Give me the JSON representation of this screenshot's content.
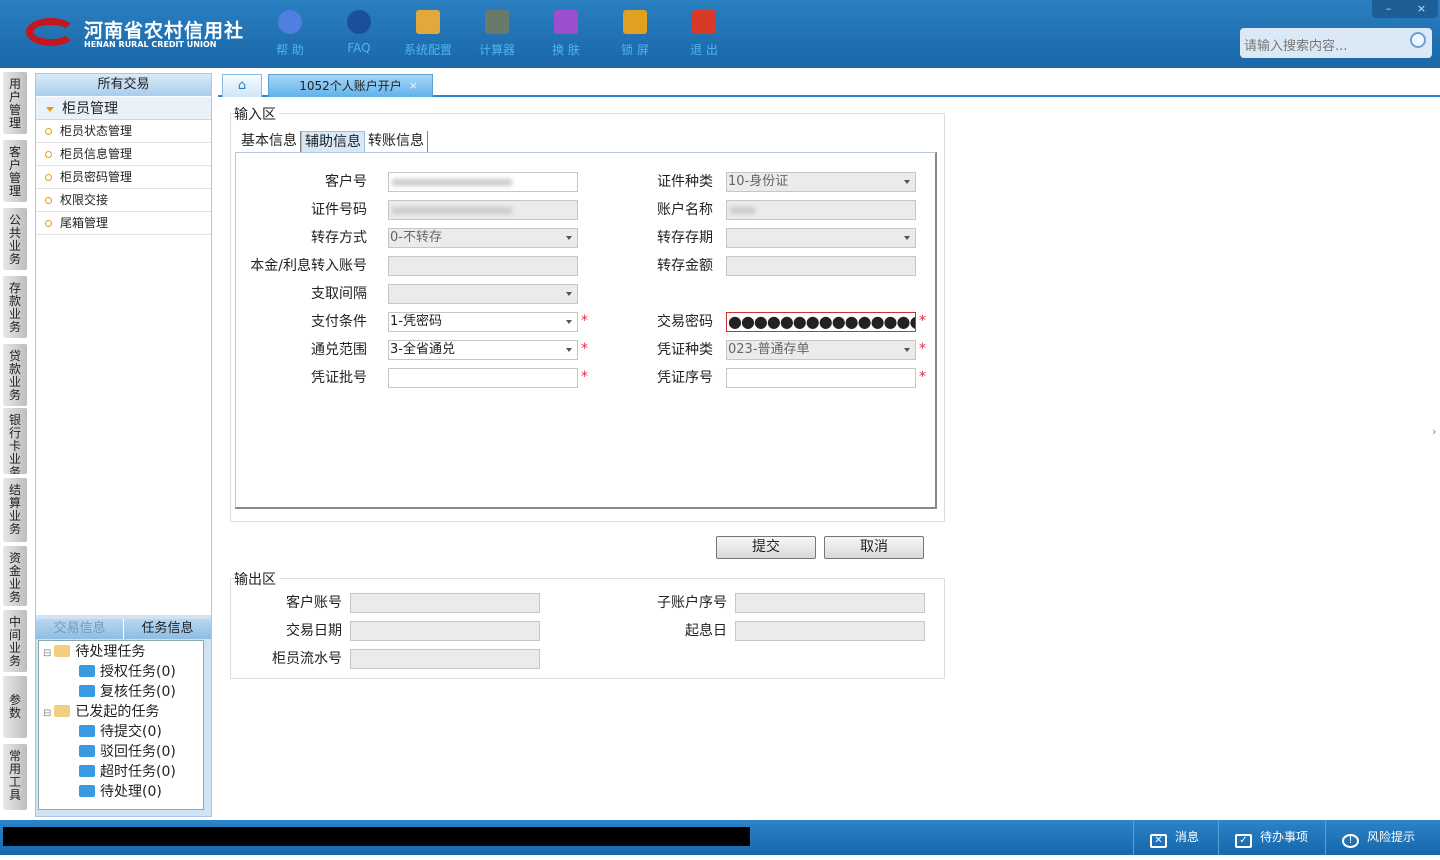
{
  "header": {
    "logo_cn": "河南省农村信用社",
    "logo_en": "HENAN RURAL CREDIT UNION",
    "tools": [
      {
        "label": "帮 助",
        "icon": "info-icon",
        "color": "#4f7fe0"
      },
      {
        "label": "FAQ",
        "icon": "question-icon",
        "color": "#1b4f99"
      },
      {
        "label": "系统配置",
        "icon": "toolbox-icon",
        "color": "#e2a83c"
      },
      {
        "label": "计算器",
        "icon": "calculator-icon",
        "color": "#6a7a6a"
      },
      {
        "label": "换 肤",
        "icon": "shirt-icon",
        "color": "#9b4fd0"
      },
      {
        "label": "锁 屏",
        "icon": "lock-icon",
        "color": "#e0a020"
      },
      {
        "label": "退 出",
        "icon": "power-icon",
        "color": "#d83a2a"
      }
    ],
    "search_placeholder": "请输入搜索内容...",
    "minimize": "–",
    "close": "×"
  },
  "vtabs": [
    "用户管理",
    "客户管理",
    "公共业务",
    "存款业务",
    "贷款业务",
    "银行卡业务",
    "结算业务",
    "资金业务",
    "中间业务",
    "参数",
    "常用工具"
  ],
  "left": {
    "header": "所有交易",
    "group": "柜员管理",
    "items": [
      "柜员状态管理",
      "柜员信息管理",
      "柜员密码管理",
      "权限交接",
      "尾箱管理"
    ],
    "bottom_tabs": [
      "交易信息",
      "任务信息"
    ],
    "tree": [
      {
        "label": "待处理任务",
        "level": 0
      },
      {
        "label": "授权任务(0)",
        "level": 1
      },
      {
        "label": "复核任务(0)",
        "level": 1
      },
      {
        "label": "已发起的任务",
        "level": 0
      },
      {
        "label": "待提交(0)",
        "level": 1
      },
      {
        "label": "驳回任务(0)",
        "level": 1
      },
      {
        "label": "超时任务(0)",
        "level": 1
      },
      {
        "label": "待处理(0)",
        "level": 1
      }
    ]
  },
  "tabs": {
    "active": "1052个人账户开户",
    "close": "×"
  },
  "input_area": {
    "legend": "输入区",
    "subtabs": [
      "基本信息",
      "辅助信息",
      "转账信息"
    ],
    "active_subtab": 1,
    "fields": [
      {
        "label": "客户号",
        "value": "",
        "blurred": true,
        "col": 0,
        "row": 0
      },
      {
        "label": "证件种类",
        "value": "10-身份证",
        "disabled": true,
        "dropdown": true,
        "col": 1,
        "row": 0
      },
      {
        "label": "证件号码",
        "value": "",
        "blurred": true,
        "disabled": true,
        "col": 0,
        "row": 1
      },
      {
        "label": "账户名称",
        "value": "",
        "blurred": true,
        "disabled": true,
        "col": 1,
        "row": 1
      },
      {
        "label": "转存方式",
        "value": "0-不转存",
        "disabled": true,
        "dropdown": true,
        "col": 0,
        "row": 2
      },
      {
        "label": "转存存期",
        "value": "",
        "disabled": true,
        "dropdown": true,
        "col": 1,
        "row": 2
      },
      {
        "label": "本金/利息转入账号",
        "value": "",
        "disabled": true,
        "col": 0,
        "row": 3
      },
      {
        "label": "转存金额",
        "value": "",
        "disabled": true,
        "col": 1,
        "row": 3
      },
      {
        "label": "支取间隔",
        "value": "",
        "disabled": true,
        "dropdown": true,
        "col": 0,
        "row": 4
      },
      {
        "label": "支付条件",
        "value": "1-凭密码",
        "dropdown": true,
        "required": true,
        "col": 0,
        "row": 5
      },
      {
        "label": "交易密码",
        "value": "●●●●●●●●●●●●●●●",
        "error": true,
        "required": true,
        "col": 1,
        "row": 5
      },
      {
        "label": "通兑范围",
        "value": "3-全省通兑",
        "dropdown": true,
        "required": true,
        "col": 0,
        "row": 6
      },
      {
        "label": "凭证种类",
        "value": "023-普通存单",
        "disabled": true,
        "dropdown": true,
        "required": true,
        "col": 1,
        "row": 6
      },
      {
        "label": "凭证批号",
        "value": "",
        "required": true,
        "col": 0,
        "row": 7
      },
      {
        "label": "凭证序号",
        "value": "",
        "required": true,
        "col": 1,
        "row": 7
      }
    ],
    "required_mark": "*"
  },
  "actions": {
    "submit": "提交",
    "cancel": "取消"
  },
  "output_area": {
    "legend": "输出区",
    "fields": [
      {
        "label": "客户账号",
        "value": "",
        "col": 0,
        "row": 0
      },
      {
        "label": "子账户序号",
        "value": "",
        "col": 1,
        "row": 0
      },
      {
        "label": "交易日期",
        "value": "",
        "col": 0,
        "row": 1
      },
      {
        "label": "起息日",
        "value": "",
        "col": 1,
        "row": 1
      },
      {
        "label": "柜员流水号",
        "value": "",
        "col": 0,
        "row": 2
      }
    ]
  },
  "status": {
    "items": [
      {
        "label": "消息",
        "icon": "mail-icon"
      },
      {
        "label": "待办事项",
        "icon": "checkbox-icon"
      },
      {
        "label": "风险提示",
        "icon": "alert-bubble-icon"
      }
    ]
  }
}
